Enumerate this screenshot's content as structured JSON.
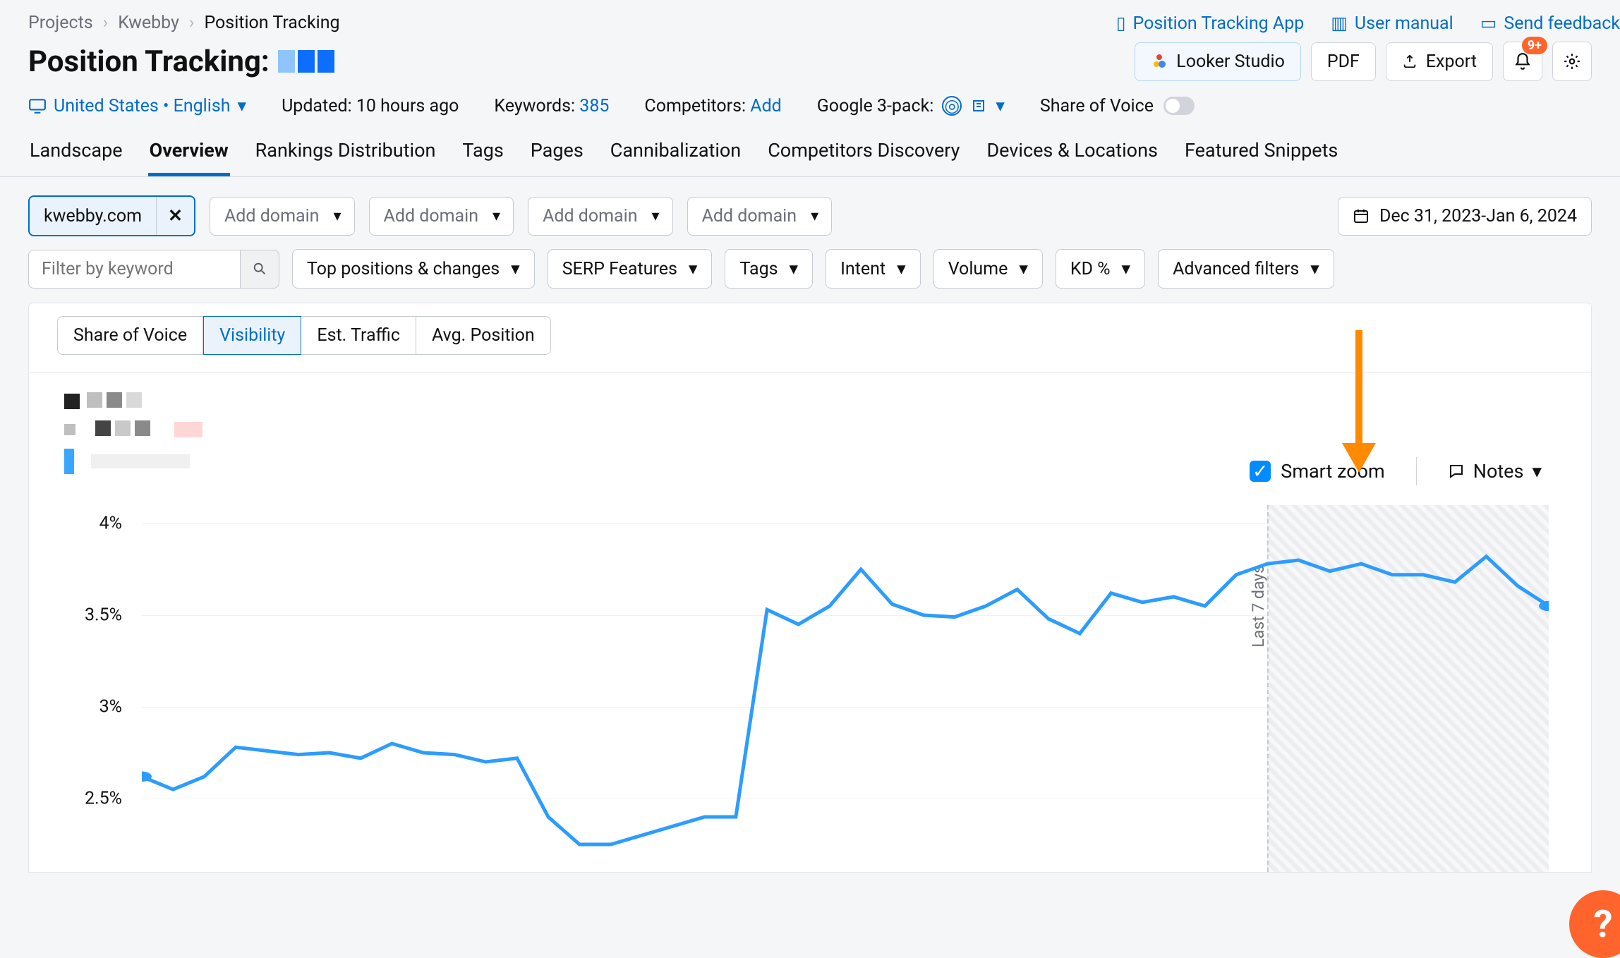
{
  "breadcrumb": {
    "items": [
      "Projects",
      "Kwebby",
      "Position Tracking"
    ]
  },
  "top_links": {
    "app": "Position Tracking App",
    "manual": "User manual",
    "feedback": "Send feedback"
  },
  "title": {
    "prefix": "Position Tracking:"
  },
  "actions": {
    "looker": "Looker Studio",
    "pdf": "PDF",
    "export": "Export",
    "bell_badge": "9+"
  },
  "meta": {
    "region": "United States • English",
    "updated_label": "Updated:",
    "updated_val": "10 hours ago",
    "keywords_label": "Keywords:",
    "keywords_val": "385",
    "competitors_label": "Competitors:",
    "competitors_val": "Add",
    "gpack_label": "Google 3-pack:",
    "sov_label": "Share of Voice"
  },
  "tabs": [
    "Landscape",
    "Overview",
    "Rankings Distribution",
    "Tags",
    "Pages",
    "Cannibalization",
    "Competitors Discovery",
    "Devices & Locations",
    "Featured Snippets"
  ],
  "active_tab": "Overview",
  "domain_chip": "kwebby.com",
  "add_domain_label": "Add domain",
  "date_range": "Dec 31, 2023-Jan 6, 2024",
  "filters": {
    "keyword_placeholder": "Filter by keyword",
    "items": [
      "Top positions & changes",
      "SERP Features",
      "Tags",
      "Intent",
      "Volume",
      "KD %",
      "Advanced filters"
    ]
  },
  "segments": [
    "Share of Voice",
    "Visibility",
    "Est. Traffic",
    "Avg. Position"
  ],
  "active_segment": "Visibility",
  "smart_zoom": "Smart zoom",
  "notes": "Notes",
  "last7": "Last 7 days",
  "chart_data": {
    "type": "line",
    "ylabel": "Visibility",
    "y_ticks": [
      "4%",
      "3.5%",
      "3%",
      "2.5%"
    ],
    "y_tick_values": [
      4.0,
      3.5,
      3.0,
      2.5
    ],
    "ylim": [
      2.1,
      4.1
    ],
    "series": [
      {
        "name": "kwebby.com",
        "values": [
          2.62,
          2.55,
          2.62,
          2.78,
          2.76,
          2.74,
          2.75,
          2.72,
          2.8,
          2.75,
          2.74,
          2.7,
          2.72,
          2.4,
          2.25,
          2.25,
          2.3,
          2.35,
          2.4,
          2.4,
          3.53,
          3.45,
          3.55,
          3.75,
          3.56,
          3.5,
          3.49,
          3.55,
          3.64,
          3.48,
          3.4,
          3.62,
          3.57,
          3.6,
          3.55,
          3.72,
          3.78,
          3.8,
          3.74,
          3.78,
          3.72,
          3.72,
          3.68,
          3.82,
          3.66,
          3.55
        ],
        "color": "#2c9cff"
      }
    ],
    "point_start": 2.62,
    "point_end": 3.55
  }
}
